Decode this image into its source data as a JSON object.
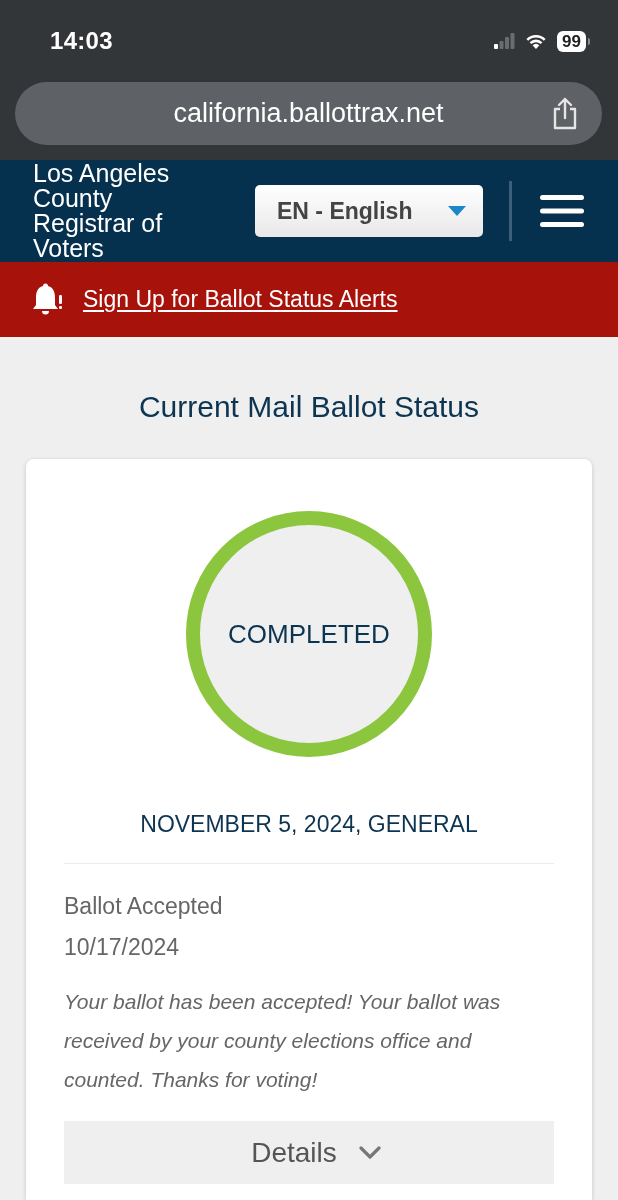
{
  "status_bar": {
    "time": "14:03",
    "battery": "99"
  },
  "browser": {
    "url": "california.ballottrax.net"
  },
  "header": {
    "logo": "Los Angeles County Registrar of Voters",
    "language": "EN - English"
  },
  "alert_banner": {
    "link": "Sign Up for Ballot Status Alerts"
  },
  "page_title": "Current Mail Ballot Status",
  "ballot_card": {
    "status": "COMPLETED",
    "election": "NOVEMBER 5, 2024, GENERAL",
    "event": "Ballot Accepted",
    "date": "10/17/2024",
    "message": "Your ballot has been accepted! Your ballot was received by your county elections office and counted. Thanks for voting!",
    "details_button": "Details"
  }
}
